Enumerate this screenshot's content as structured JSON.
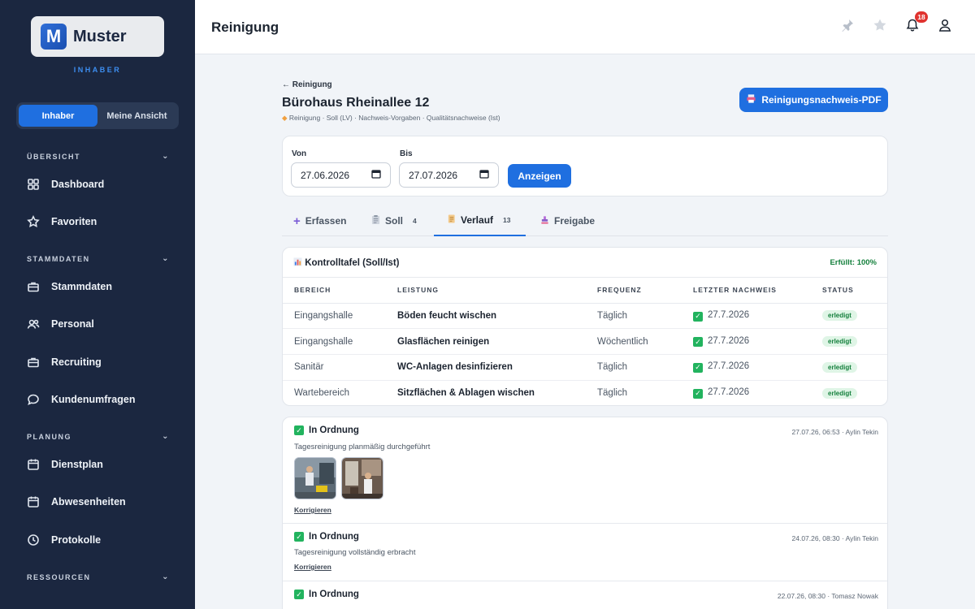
{
  "sidebar": {
    "logo_text": "Muster",
    "logo_mark": "M",
    "role": "INHABER",
    "toggle": [
      "Inhaber",
      "Meine Ansicht"
    ],
    "sections": [
      {
        "title": "ÜBERSICHT"
      },
      {
        "title": "STAMMDATEN"
      },
      {
        "title": "PLANUNG"
      },
      {
        "title": "RESSOURCEN"
      }
    ],
    "items": [
      {
        "label": "Dashboard",
        "icon": "grid-icon"
      },
      {
        "label": "Favoriten",
        "icon": "star-icon"
      },
      {
        "label": "Stammdaten",
        "icon": "briefcase-icon"
      },
      {
        "label": "Personal",
        "icon": "people-icon"
      },
      {
        "label": "Recruiting",
        "icon": "briefcase-icon"
      },
      {
        "label": "Kundenumfragen",
        "icon": "chat-icon"
      },
      {
        "label": "Dienstplan",
        "icon": "calendar-icon"
      },
      {
        "label": "Abwesenheiten",
        "icon": "calendar-icon"
      },
      {
        "label": "Protokolle",
        "icon": "clock-icon"
      }
    ]
  },
  "header": {
    "title": "Reinigung",
    "notifications_count": "18"
  },
  "object": {
    "back": "← Reinigung",
    "title": "Bürohaus Rheinallee 12",
    "subtitle": "Reinigung · Soll (LV) · Nachweis-Vorgaben · Qualitätsnachweise (Ist)",
    "pdf_button": "Reinigungsnachweis-PDF"
  },
  "filter": {
    "from_label": "Von",
    "from_value": "27.06.2026",
    "to_label": "Bis",
    "to_value": "27.07.2026",
    "show_button": "Anzeigen"
  },
  "tabs": [
    {
      "label": "Erfassen",
      "count": ""
    },
    {
      "label": "Soll",
      "count": "4"
    },
    {
      "label": "Verlauf",
      "count": "13"
    },
    {
      "label": "Freigabe",
      "count": ""
    }
  ],
  "control": {
    "title": "Kontrolltafel (Soll/Ist)",
    "fulfilled": "Erfüllt: 100%",
    "columns": [
      "BEREICH",
      "LEISTUNG",
      "FREQUENZ",
      "LETZTER NACHWEIS",
      "STATUS"
    ],
    "rows": [
      {
        "area": "Eingangshalle",
        "task": "Böden feucht wischen",
        "freq": "Täglich",
        "last": "27.7.2026",
        "status": "erledigt"
      },
      {
        "area": "Eingangshalle",
        "task": "Glasflächen reinigen",
        "freq": "Wöchentlich",
        "last": "27.7.2026",
        "status": "erledigt"
      },
      {
        "area": "Sanitär",
        "task": "WC-Anlagen desinfizieren",
        "freq": "Täglich",
        "last": "27.7.2026",
        "status": "erledigt"
      },
      {
        "area": "Wartebereich",
        "task": "Sitzflächen & Ablagen wischen",
        "freq": "Täglich",
        "last": "27.7.2026",
        "status": "erledigt"
      }
    ]
  },
  "log": [
    {
      "status": "In Ordnung",
      "meta": "27.07.26, 06:53 · Aylin Tekin",
      "desc": "Tagesreinigung planmäßig durchgeführt",
      "link": "Korrigieren"
    },
    {
      "status": "In Ordnung",
      "meta": "24.07.26, 08:30 · Aylin Tekin",
      "desc": "Tagesreinigung vollständig erbracht",
      "link": "Korrigieren"
    },
    {
      "status": "In Ordnung",
      "meta": "22.07.26, 08:30 · Tomasz Nowak"
    }
  ],
  "colors": {
    "accent": "#1f6fe0",
    "sidebar": "#1b2740",
    "success": "#22b35e"
  }
}
